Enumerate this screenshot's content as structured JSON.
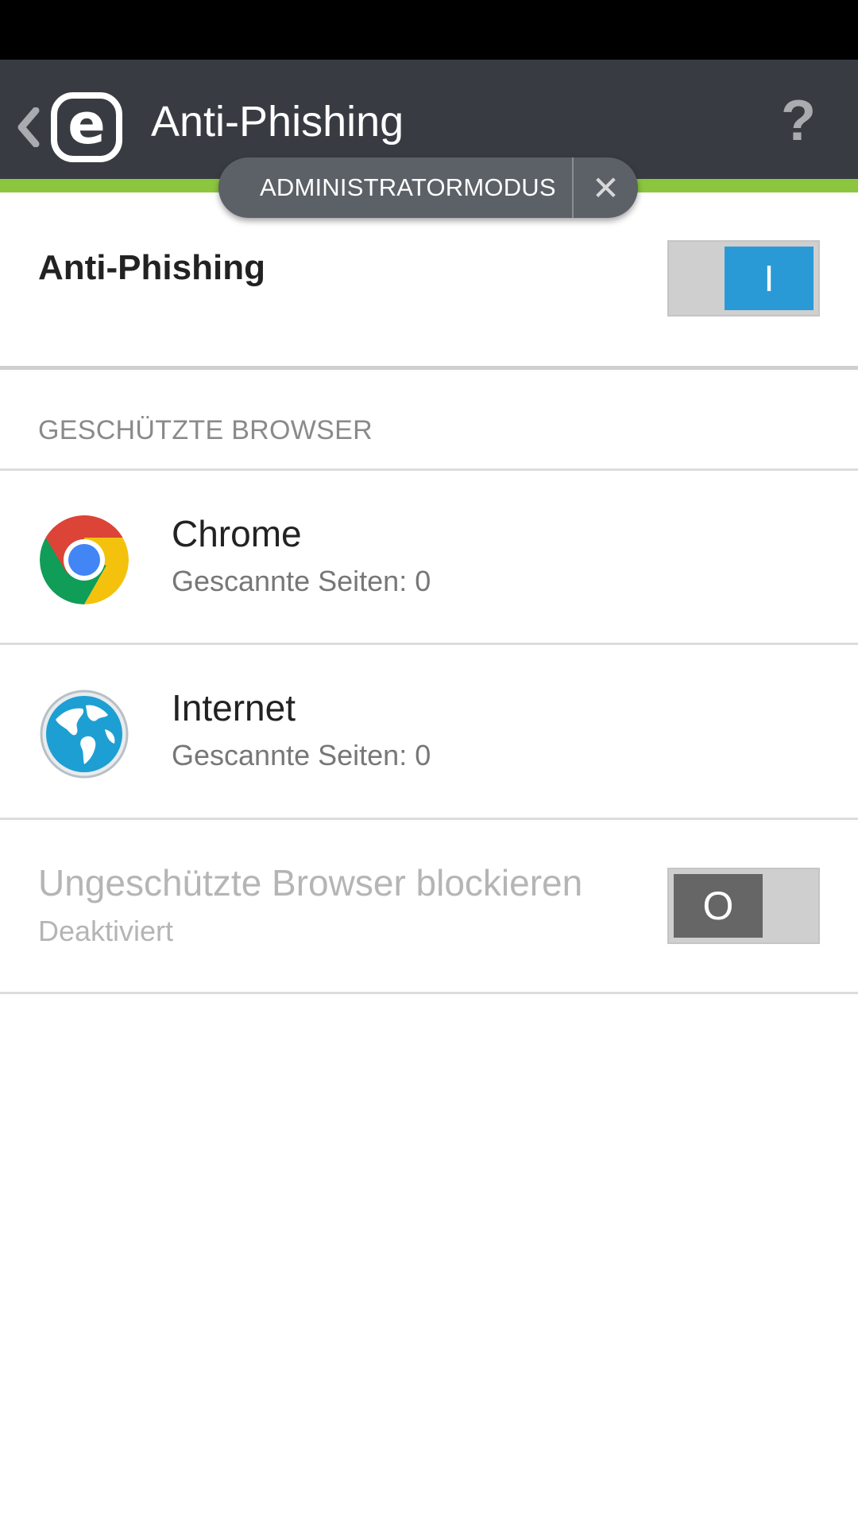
{
  "header": {
    "title": "Anti-Phishing",
    "logo_letter": "e",
    "back_icon": "chevron-left-icon",
    "help_icon": "?",
    "bar_color": "#383c42",
    "accent_color": "#8cc63f"
  },
  "admin_mode": {
    "label": "ADMINISTRATORMODUS",
    "close_icon": "✕"
  },
  "main_toggle": {
    "label": "Anti-Phishing",
    "state": "on",
    "state_glyph": "I",
    "color": "#2a9ad7"
  },
  "protected_browsers": {
    "header": "GESCHÜTZTE BROWSER",
    "items": [
      {
        "name": "Chrome",
        "detail": "Gescannte Seiten: 0",
        "icon": "chrome-icon"
      },
      {
        "name": "Internet",
        "detail": "Gescannte Seiten: 0",
        "icon": "globe-icon"
      }
    ]
  },
  "block_unprotected": {
    "label": "Ungeschützte Browser blockieren",
    "status": "Deaktiviert",
    "state": "off",
    "state_glyph": "O",
    "enabled": false
  }
}
